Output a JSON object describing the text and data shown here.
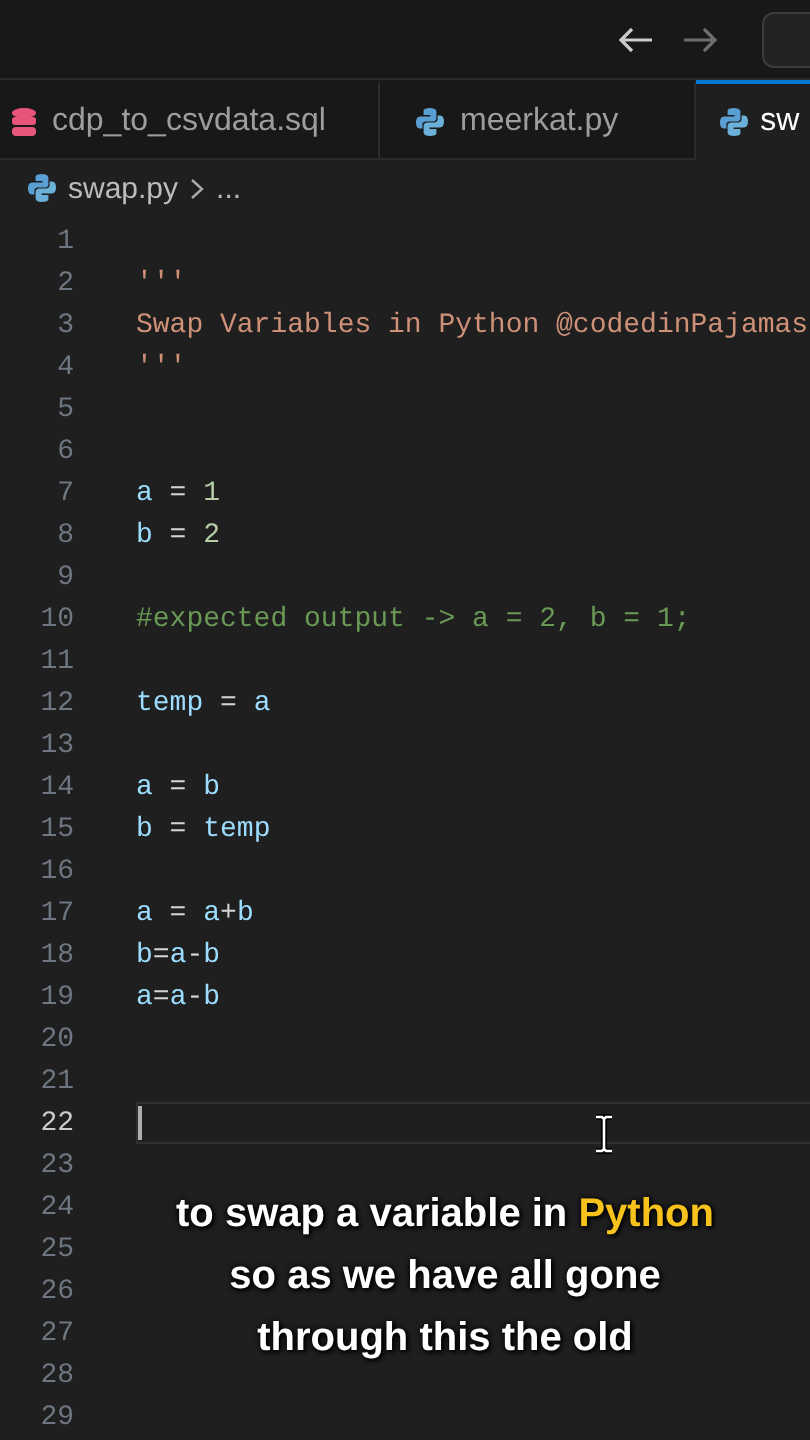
{
  "nav_buttons": [
    {
      "kind": "back",
      "disabled": false
    },
    {
      "kind": "forward",
      "disabled": true
    }
  ],
  "tabs": [
    {
      "label": "cdp_to_csvdata.sql",
      "kind": "database",
      "selected": false
    },
    {
      "label": "meerkat.py",
      "kind": "python",
      "selected": false
    },
    {
      "label": "sw",
      "kind": "python",
      "selected": true
    }
  ],
  "breadcrumb": {
    "file": "swap.py",
    "rest": "..."
  },
  "editor": {
    "lines": [
      {
        "number": "1",
        "current": false
      },
      {
        "number": "2",
        "current": false,
        "tokens": [
          {
            "text": "'''",
            "kind": "string"
          }
        ]
      },
      {
        "number": "3",
        "current": false,
        "tokens": [
          {
            "text": "Swap Variables in Python @codedinPajamas",
            "kind": "string"
          }
        ]
      },
      {
        "number": "4",
        "current": false,
        "tokens": [
          {
            "text": "'''",
            "kind": "string"
          }
        ]
      },
      {
        "number": "5",
        "current": false
      },
      {
        "number": "6",
        "current": false
      },
      {
        "number": "7",
        "current": false,
        "tokens": [
          {
            "text": "a",
            "kind": "variable"
          },
          {
            "text": " = ",
            "kind": "operator"
          },
          {
            "text": "1",
            "kind": "number"
          }
        ]
      },
      {
        "number": "8",
        "current": false,
        "tokens": [
          {
            "text": "b",
            "kind": "variable"
          },
          {
            "text": " = ",
            "kind": "operator"
          },
          {
            "text": "2",
            "kind": "number"
          }
        ]
      },
      {
        "number": "9",
        "current": false
      },
      {
        "number": "10",
        "current": false,
        "tokens": [
          {
            "text": "#expected output -> a = 2, b = 1;",
            "kind": "comment"
          }
        ]
      },
      {
        "number": "11",
        "current": false
      },
      {
        "number": "12",
        "current": false,
        "tokens": [
          {
            "text": "temp",
            "kind": "variable"
          },
          {
            "text": " = ",
            "kind": "operator"
          },
          {
            "text": "a",
            "kind": "variable"
          }
        ]
      },
      {
        "number": "13",
        "current": false
      },
      {
        "number": "14",
        "current": false,
        "tokens": [
          {
            "text": "a",
            "kind": "variable"
          },
          {
            "text": " = ",
            "kind": "operator"
          },
          {
            "text": "b",
            "kind": "variable"
          }
        ]
      },
      {
        "number": "15",
        "current": false,
        "tokens": [
          {
            "text": "b",
            "kind": "variable"
          },
          {
            "text": " = ",
            "kind": "operator"
          },
          {
            "text": "temp",
            "kind": "variable"
          }
        ]
      },
      {
        "number": "16",
        "current": false
      },
      {
        "number": "17",
        "current": false,
        "tokens": [
          {
            "text": "a",
            "kind": "variable"
          },
          {
            "text": " = ",
            "kind": "operator"
          },
          {
            "text": "a",
            "kind": "variable"
          },
          {
            "text": "+",
            "kind": "operator"
          },
          {
            "text": "b",
            "kind": "variable"
          }
        ]
      },
      {
        "number": "18",
        "current": false,
        "tokens": [
          {
            "text": "b",
            "kind": "variable"
          },
          {
            "text": "=",
            "kind": "operator"
          },
          {
            "text": "a",
            "kind": "variable"
          },
          {
            "text": "-",
            "kind": "operator"
          },
          {
            "text": "b",
            "kind": "variable"
          }
        ]
      },
      {
        "number": "19",
        "current": false,
        "tokens": [
          {
            "text": "a",
            "kind": "variable"
          },
          {
            "text": "=",
            "kind": "operator"
          },
          {
            "text": "a",
            "kind": "variable"
          },
          {
            "text": "-",
            "kind": "operator"
          },
          {
            "text": "b",
            "kind": "variable"
          }
        ]
      },
      {
        "number": "20",
        "current": false
      },
      {
        "number": "21",
        "current": false
      },
      {
        "number": "22",
        "current": true
      },
      {
        "number": "23",
        "current": false
      },
      {
        "number": "24",
        "current": false
      },
      {
        "number": "25",
        "current": false
      },
      {
        "number": "26",
        "current": false
      },
      {
        "number": "27",
        "current": false
      },
      {
        "number": "28",
        "current": false
      },
      {
        "number": "29",
        "current": false
      }
    ]
  },
  "caption": {
    "lines": [
      {
        "segments": [
          {
            "text": "to swap a variable in ",
            "highlight": false
          },
          {
            "text": "Python",
            "highlight": true
          }
        ]
      },
      {
        "segments": [
          {
            "text": "so as we have all gone",
            "highlight": false
          }
        ]
      },
      {
        "segments": [
          {
            "text": "through this the old",
            "highlight": false
          }
        ]
      }
    ]
  }
}
